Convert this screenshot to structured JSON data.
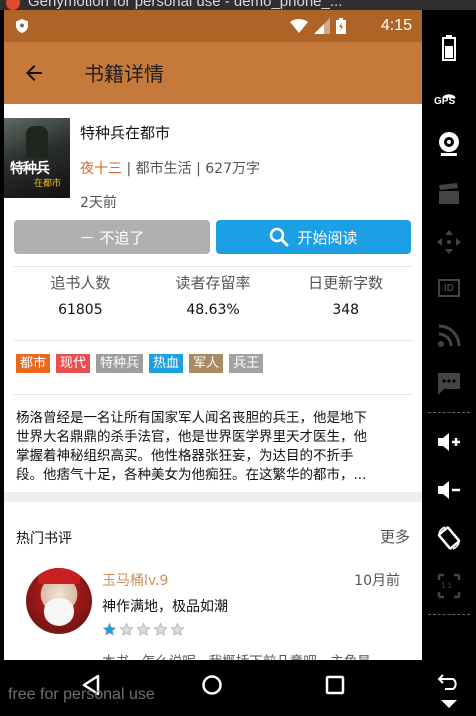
{
  "window": {
    "title": "Genymotion for personal use - demo_phone_..."
  },
  "statusbar": {
    "time": "4:15"
  },
  "toolbar": {
    "title": "书籍详情"
  },
  "book": {
    "name": "特种兵在都市",
    "author": "夜十三",
    "category": "都市生活",
    "word_count": "627万字",
    "updated": "2天前",
    "cover_text": "特种兵",
    "cover_subtext": "在都市"
  },
  "actions": {
    "unfollow_label": "－ 不追了",
    "read_label": "开始阅读"
  },
  "stats": [
    {
      "label": "追书人数",
      "value": "61805"
    },
    {
      "label": "读者存留率",
      "value": "48.63%"
    },
    {
      "label": "日更新字数",
      "value": "348"
    }
  ],
  "tags": [
    {
      "label": "都市",
      "color": "#e96a1e"
    },
    {
      "label": "现代",
      "color": "#e8504f"
    },
    {
      "label": "特种兵",
      "color": "#9e9e9e"
    },
    {
      "label": "热血",
      "color": "#1da0e2"
    },
    {
      "label": "军人",
      "color": "#a88a63"
    },
    {
      "label": "兵王",
      "color": "#a3a3a3"
    }
  ],
  "intro": [
    "杨洛曾经是一名让所有国家军人闻名丧胆的兵王，他是地下",
    "世界大名鼎鼎的杀手法官，他是世界医学界里天才医生，他",
    "掌握着神秘组织高买。他性格器张狂妄，为达目的不折手",
    "段。他痞气十足，各种美女为他痴狂。在这繁华的都市，..."
  ],
  "reviews": {
    "title": "热门书评",
    "more_label": "更多",
    "items": [
      {
        "user": "玉马桶lv.9",
        "date": "10月前",
        "title": "神作满地，极品如潮",
        "rating": 1,
        "max_rating": 5,
        "excerpt": "本书...怎么说呢...我概括下前几章吧。主角是"
      }
    ]
  },
  "watermark": "free for personal use",
  "colors": {
    "accent": "#c57a3b",
    "statusbar": "#ad6426",
    "primary_button": "#1d9fe6",
    "author": "#d26a2a"
  },
  "sidepanel": {
    "gps_label": "GPS",
    "id_label": "ID",
    "scale_label": "1:1"
  }
}
